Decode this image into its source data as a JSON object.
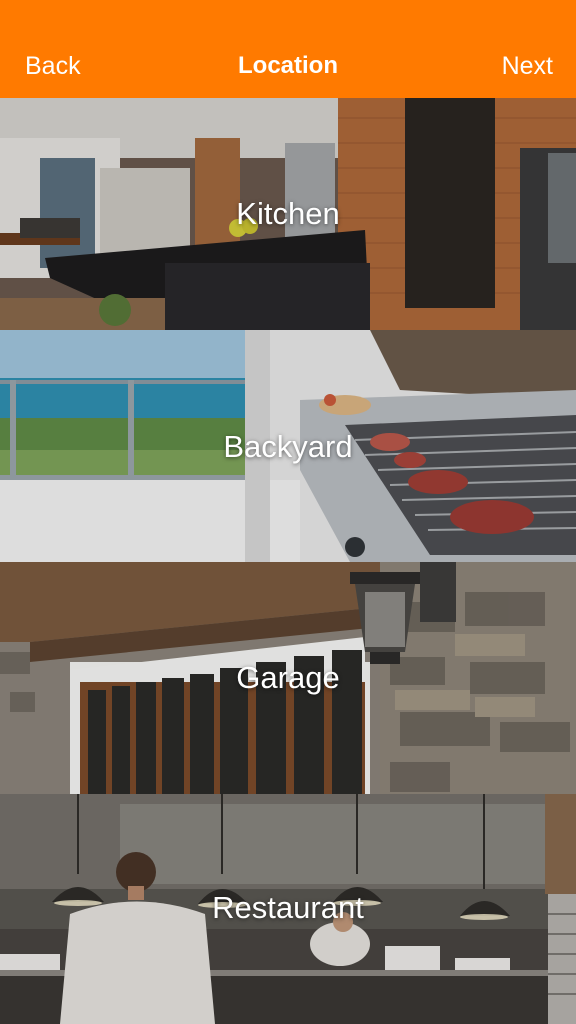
{
  "header": {
    "back_label": "Back",
    "title": "Location",
    "next_label": "Next",
    "background_color": "#ff7a00"
  },
  "locations": [
    {
      "label": "Kitchen"
    },
    {
      "label": "Backyard"
    },
    {
      "label": "Garage"
    },
    {
      "label": "Restaurant"
    }
  ]
}
